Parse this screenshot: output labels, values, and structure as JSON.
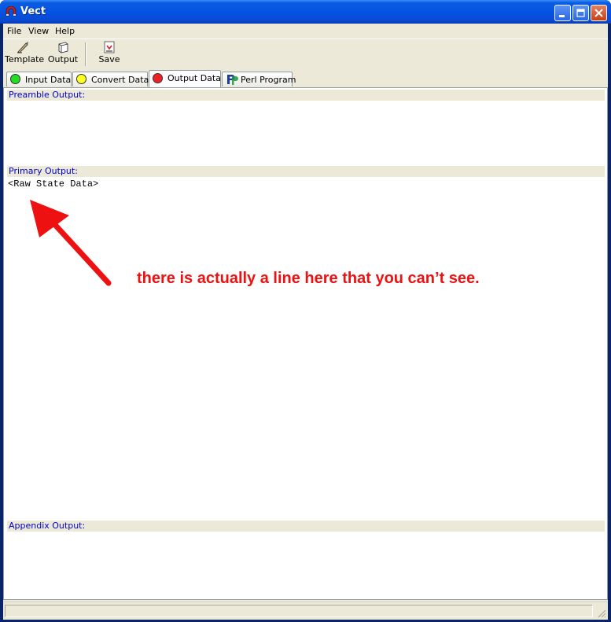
{
  "window": {
    "title": "Vect",
    "icons": {
      "app": "horseshoe-magnet-icon",
      "minimize": "minimize-icon",
      "maximize": "maximize-icon",
      "close": "close-icon"
    }
  },
  "menu": [
    "File",
    "View",
    "Help"
  ],
  "toolbar": [
    {
      "label": "Template",
      "icon": "quill-pen-icon"
    },
    {
      "label": "Output",
      "icon": "box-icon"
    },
    {
      "label": "Save",
      "icon": "save-icon"
    }
  ],
  "tabs": [
    {
      "label": "Input Data",
      "color": "#22dd22"
    },
    {
      "label": "Convert Data",
      "color": "#ffff22"
    },
    {
      "label": "Output Data",
      "color": "#ee2222"
    },
    {
      "label": "Perl Program",
      "icon": "perl-p-icon"
    }
  ],
  "sections": {
    "preamble": {
      "header": "Preamble Output:",
      "content": ""
    },
    "primary": {
      "header": "Primary Output:",
      "content": "<Raw State Data>"
    },
    "appendix": {
      "header": "Appendix Output:",
      "content": ""
    }
  },
  "annotation": {
    "text": "there is actually a line here that you can’t see.",
    "color": "#ee1111"
  },
  "colors": {
    "titlebar": "#0553e4",
    "section_header_text": "#0000cc",
    "chrome": "#ece9d8"
  }
}
